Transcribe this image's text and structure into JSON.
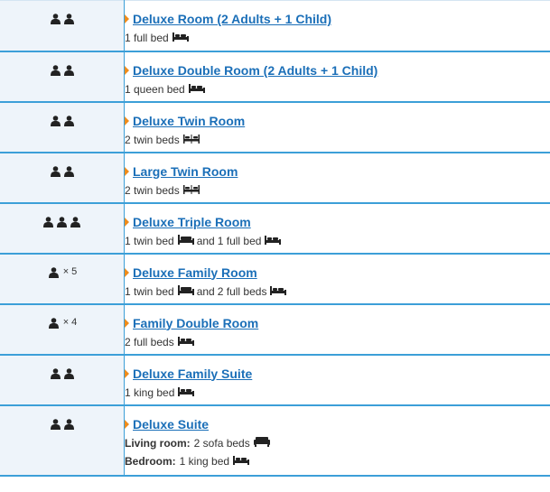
{
  "rooms": [
    {
      "occupancy_icons": 2,
      "occupancy_times": "",
      "name": "Deluxe Room (2 Adults + 1 Child)",
      "bed": "1 full bed",
      "bed_icon": "full-bed-icon"
    },
    {
      "occupancy_icons": 2,
      "occupancy_times": "",
      "name": "Deluxe Double Room (2 Adults + 1 Child)",
      "bed": "1 queen bed",
      "bed_icon": "queen-bed-icon"
    },
    {
      "occupancy_icons": 2,
      "occupancy_times": "",
      "name": "Deluxe Twin Room",
      "bed": "2 twin beds",
      "bed_icon": "twin-beds-icon"
    },
    {
      "occupancy_icons": 2,
      "occupancy_times": "",
      "name": "Large Twin Room",
      "bed": "2 twin beds",
      "bed_icon": "twin-beds-icon"
    },
    {
      "occupancy_icons": 3,
      "occupancy_times": "",
      "name": "Deluxe Triple Room",
      "bed": "1 twin bed",
      "bed_conj": "and",
      "bed2": "1 full bed",
      "bed_icon": "twin-bed-icon",
      "bed2_icon": "full-bed-icon"
    },
    {
      "occupancy_icons": 1,
      "occupancy_times": "× 5",
      "name": "Deluxe Family Room",
      "bed": "1 twin bed",
      "bed_conj": "and",
      "bed2": "2 full beds",
      "bed_icon": "twin-bed-icon",
      "bed2_icon": "full-bed-icon"
    },
    {
      "occupancy_icons": 1,
      "occupancy_times": "× 4",
      "name": "Family Double Room",
      "bed": "2 full beds",
      "bed_icon": "full-bed-icon"
    },
    {
      "occupancy_icons": 2,
      "occupancy_times": "",
      "name": "Deluxe Family Suite",
      "bed": "1 king bed",
      "bed_icon": "king-bed-icon"
    },
    {
      "occupancy_icons": 2,
      "occupancy_times": "",
      "name": "Deluxe Suite",
      "living_label": "Living room:",
      "living_bed": "2 sofa beds",
      "bedroom_label": "Bedroom:",
      "bedroom_bed": "1 king bed",
      "bed_icon": "sofa-bed-icon",
      "bed2_icon": "king-bed-icon"
    }
  ],
  "colors": {
    "link": "#1b6fb8",
    "border": "#3c9fd8",
    "arrow": "#f08c1a",
    "occupancy_bg": "#eef4fa"
  }
}
